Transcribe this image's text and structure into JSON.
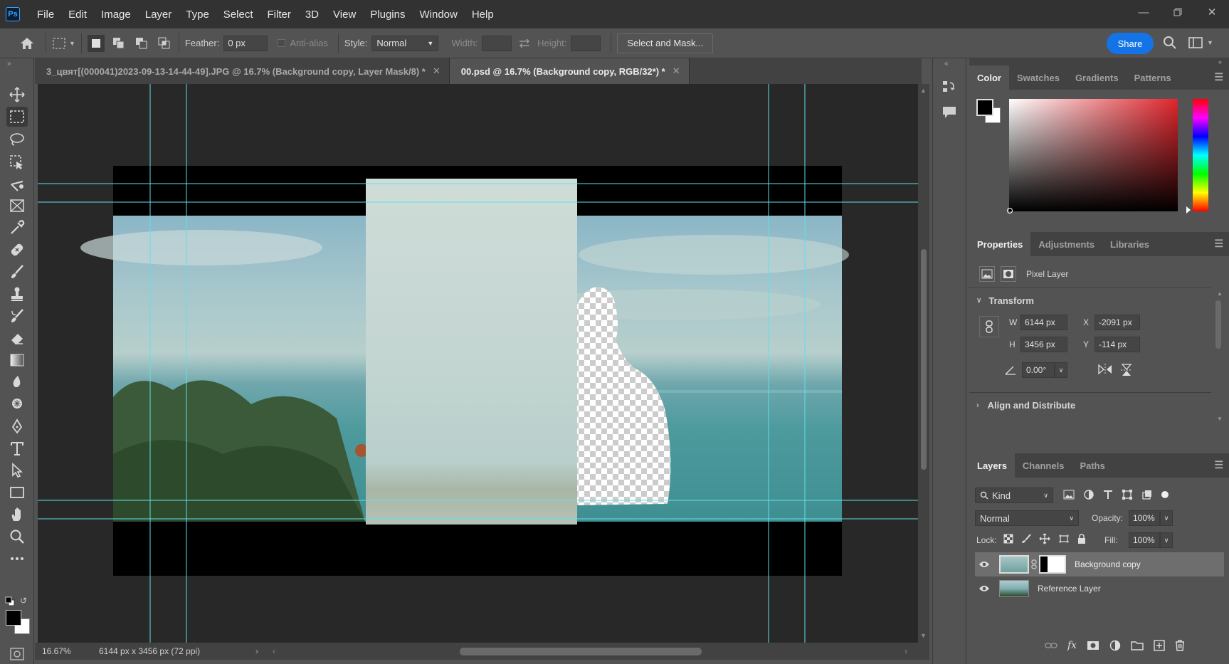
{
  "menubar": {
    "logo": "Ps",
    "items": [
      "File",
      "Edit",
      "Image",
      "Layer",
      "Type",
      "Select",
      "Filter",
      "3D",
      "View",
      "Plugins",
      "Window",
      "Help"
    ]
  },
  "options": {
    "feather_label": "Feather:",
    "feather_value": "0 px",
    "antialias_label": "Anti-alias",
    "style_label": "Style:",
    "style_value": "Normal",
    "width_label": "Width:",
    "height_label": "Height:",
    "select_mask_label": "Select and Mask...",
    "share_label": "Share"
  },
  "doc_tabs": [
    {
      "label": "3_цвят[(000041)2023-09-13-14-44-49].JPG @ 16.7% (Background copy, Layer Mask/8) *"
    },
    {
      "label": "00.psd @ 16.7% (Background copy, RGB/32*) *"
    }
  ],
  "status": {
    "zoom": "16.67%",
    "doc_info": "6144 px x 3456 px (72 ppi)"
  },
  "color_panel": {
    "tabs": [
      "Color",
      "Swatches",
      "Gradients",
      "Patterns"
    ],
    "accent": "#e0252c"
  },
  "properties_panel": {
    "tabs": [
      "Properties",
      "Adjustments",
      "Libraries"
    ],
    "layer_type": "Pixel Layer",
    "transform_title": "Transform",
    "w_label": "W",
    "w_value": "6144 px",
    "h_label": "H",
    "h_value": "3456 px",
    "x_label": "X",
    "x_value": "-2091 px",
    "y_label": "Y",
    "y_value": "-114 px",
    "angle_value": "0.00°",
    "align_title": "Align and Distribute"
  },
  "layers_panel": {
    "tabs": [
      "Layers",
      "Channels",
      "Paths"
    ],
    "filter_kind": "Kind",
    "blend_mode": "Normal",
    "opacity_label": "Opacity:",
    "opacity_value": "100%",
    "lock_label": "Lock:",
    "fill_label": "Fill:",
    "fill_value": "100%",
    "layers": [
      {
        "name": "Background copy",
        "selected": true
      },
      {
        "name": "Reference Layer",
        "selected": false
      }
    ]
  }
}
